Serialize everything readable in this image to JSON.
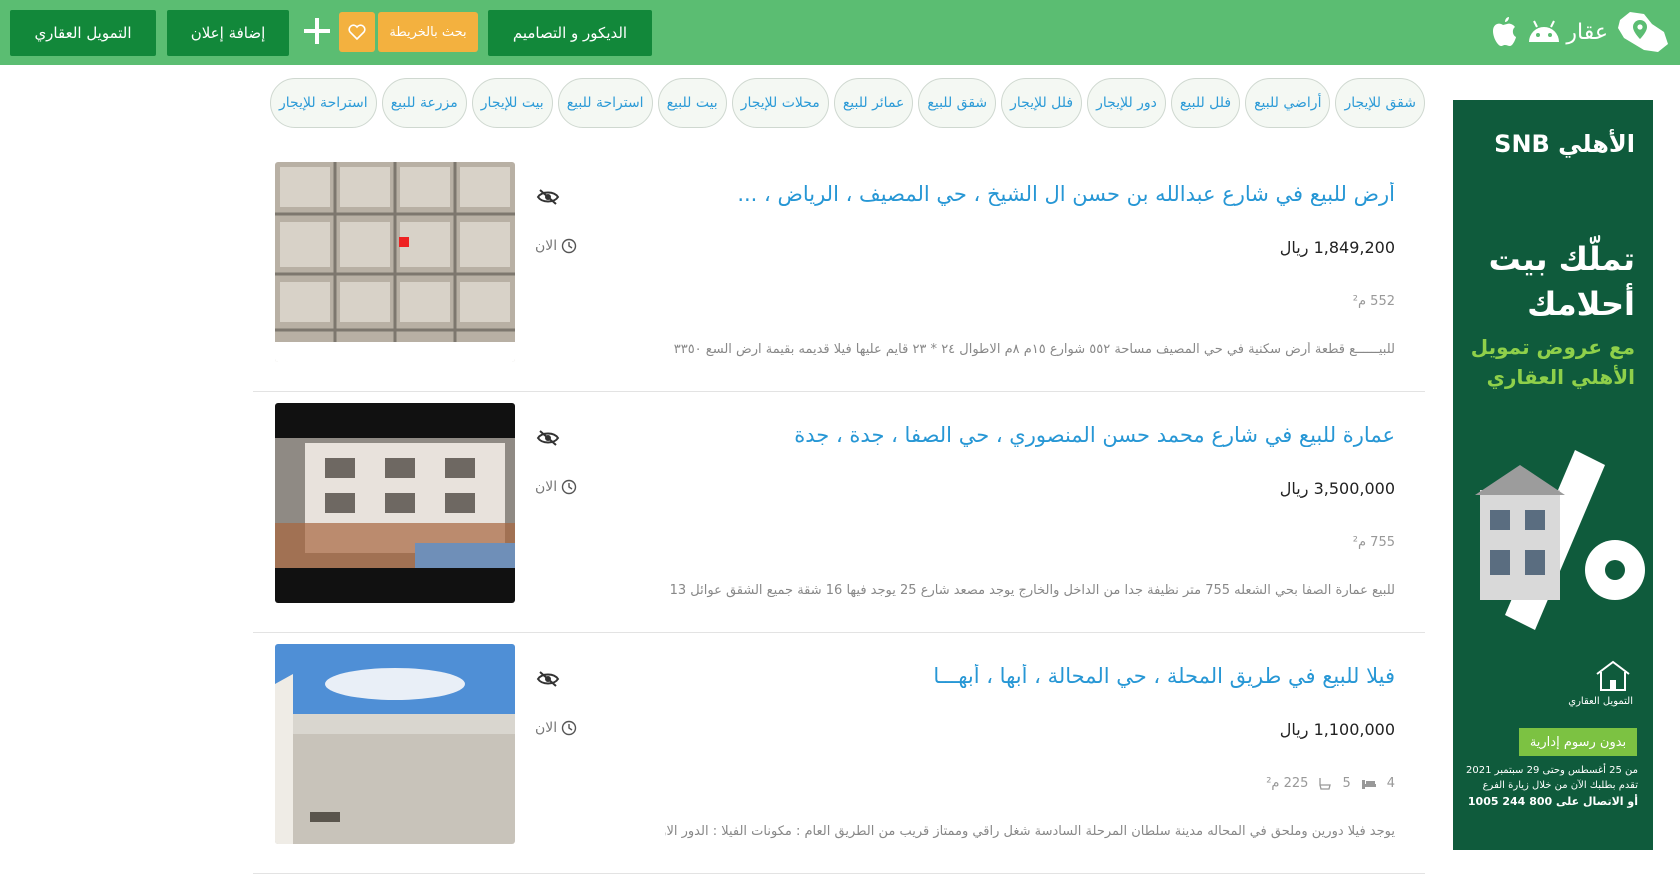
{
  "header": {
    "logo_text": "عقار",
    "finance_button": "التمويل العقاري",
    "add_ad_button": "إضافة إعلان",
    "map_search_button": "بحث بالخريطة",
    "decor_button": "الديكور و التصاميم"
  },
  "filters": [
    "شقق للإيجار",
    "أراضي للبيع",
    "فلل للبيع",
    "دور للإيجار",
    "فلل للإيجار",
    "شقق للبيع",
    "عمائر للبيع",
    "محلات للإيجار",
    "بيت للبيع",
    "استراحة للبيع",
    "بيت للإيجار",
    "مزرعة للبيع",
    "استراحة للإيجار"
  ],
  "listings": [
    {
      "title": "أرض للبيع في شارع عبدالله بن حسن ال الشيخ ، حي المصيف ، الرياض ، ...",
      "price": "1,849,200 ريال",
      "time": "الان",
      "area": "552 م²",
      "beds": "",
      "baths": "",
      "description": "للبيــــــع قطعة أرض سكنية في حي المصيف مساحة ٥٥٢ شوارع ١٥م ٨م الاطوال ٢٤ * ٢٣ قايم عليها فيلا قديمه بقيمة ارض السع ٣٣٥٠"
    },
    {
      "title": "عمارة للبيع في شارع محمد حسن المنصوري ، حي الصفا ، جدة ، جدة",
      "price": "3,500,000 ريال",
      "time": "الان",
      "area": "755 م²",
      "beds": "",
      "baths": "",
      "description": "للبيع عمارة الصفا بحي الشعله 755 متر نظيفة جدا من الداخل والخارج يوجد مصعد شارع 25 يوجد فيها 16 شقة جميع الشقق عوائل 13"
    },
    {
      "title": "فيلا للبيع في طريق المحلة ، حي المحالة ، أبها ، أبهـــا",
      "price": "1,100,000 ريال",
      "time": "الان",
      "area": "225 م²",
      "beds": "4",
      "baths": "5",
      "description": "يوجد فيلا دورين وملحق في المحاله مدينة سلطان المرحلة السادسة شغل راقي وممتاز قريب من الطريق العام : مكونات الفيلا : الدور الاول"
    }
  ],
  "ad": {
    "brand": "الأهلي SNB",
    "line1": "تملّك بيت",
    "line2": "أحلامك",
    "line3": "مع عروض تمويل",
    "line4": "الأهلي العقاري",
    "badge_label": "التمويل العقاري",
    "cta": "بدون رسوم إدارية",
    "date_text": "من 25 أغسطس وحتى 29 سبتمبر 2021",
    "apply_text": "تقدم بطلبك الآن من خلال زيارة الفرع",
    "phone_text": "أو الاتصال على 800 244 1005"
  },
  "colors": {
    "header_green": "#5bbd72",
    "button_dark_green": "#12883a",
    "orange": "#f3b13f",
    "link_blue": "#2797d5"
  }
}
